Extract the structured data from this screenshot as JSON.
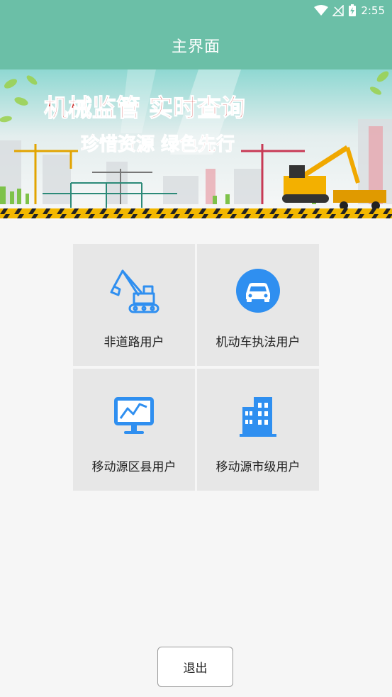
{
  "status_bar": {
    "time": "2:55",
    "icons": [
      "wifi-icon",
      "signal-icon",
      "battery-charging-icon"
    ]
  },
  "header": {
    "title": "主界面"
  },
  "banner": {
    "headline": "机械监管  实时查询",
    "slogan": "珍惜资源  绿色先行"
  },
  "menu": {
    "tiles": [
      {
        "label": "非道路用户",
        "icon": "excavator-icon"
      },
      {
        "label": "机动车执法用户",
        "icon": "car-icon"
      },
      {
        "label": "移动源区县用户",
        "icon": "monitor-chart-icon"
      },
      {
        "label": "移动源市级用户",
        "icon": "buildings-icon"
      }
    ]
  },
  "footer": {
    "logout_label": "退出"
  },
  "colors": {
    "appbar": "#6bbfa7",
    "icon_blue": "#2f8ff0",
    "banner_red": "#c8201e",
    "tile_bg": "#e7e7e7"
  }
}
